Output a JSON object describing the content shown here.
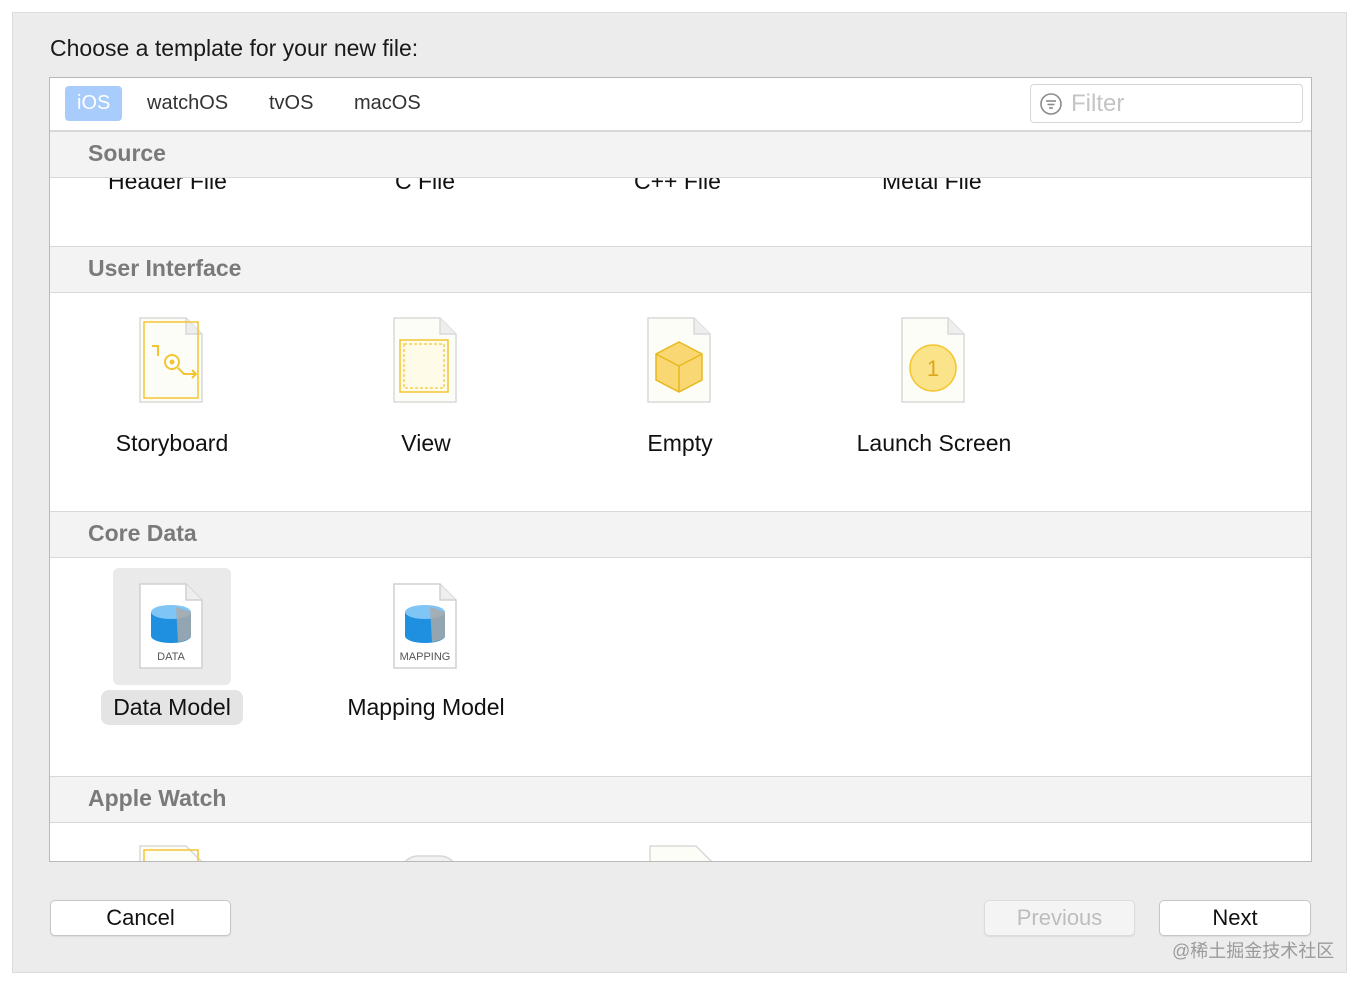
{
  "title": "Choose a template for your new file:",
  "tabs": [
    {
      "label": "iOS",
      "selected": true
    },
    {
      "label": "watchOS",
      "selected": false
    },
    {
      "label": "tvOS",
      "selected": false
    },
    {
      "label": "macOS",
      "selected": false
    }
  ],
  "filter": {
    "placeholder": "Filter"
  },
  "sections": {
    "source": {
      "title": "Source",
      "items": [
        "Header File",
        "C File",
        "C++ File",
        "Metal File"
      ]
    },
    "user_interface": {
      "title": "User Interface",
      "items": [
        "Storyboard",
        "View",
        "Empty",
        "Launch Screen"
      ]
    },
    "core_data": {
      "title": "Core Data",
      "items": [
        "Data Model",
        "Mapping Model"
      ],
      "selected": "Data Model",
      "icon_captions": [
        "DATA",
        "MAPPING"
      ]
    },
    "apple_watch": {
      "title": "Apple Watch"
    }
  },
  "launch_screen_badge": "1",
  "buttons": {
    "cancel": "Cancel",
    "previous": "Previous",
    "next": "Next"
  },
  "watermark": "@稀土掘金技术社区",
  "colors": {
    "accent_tab": "#a8ccfb",
    "icon_yellow": "#f3c531",
    "db_blue": "#1f8fe0"
  }
}
